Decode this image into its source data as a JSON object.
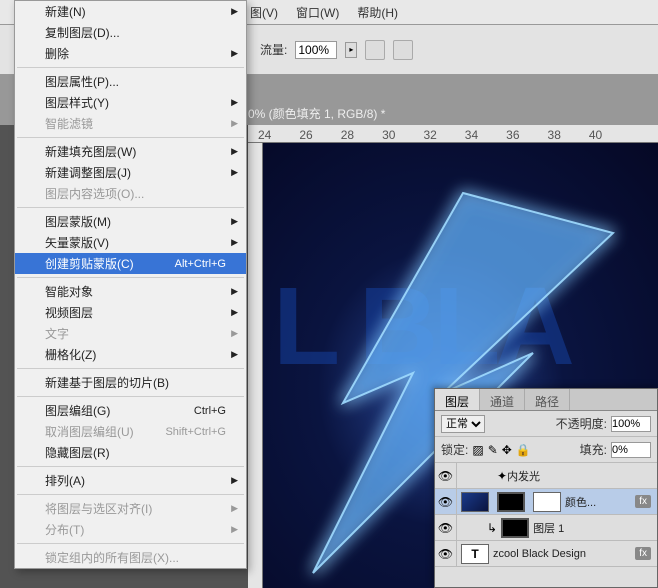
{
  "topmenu": {
    "view": "图(V)",
    "window": "窗口(W)",
    "help": "帮助(H)"
  },
  "toolbar": {
    "flow_label": "流量:",
    "flow_value": "100%"
  },
  "doc": {
    "title": "0% (颜色填充 1, RGB/8) *"
  },
  "ruler": [
    "24",
    "26",
    "28",
    "30",
    "32",
    "34",
    "36",
    "38",
    "40"
  ],
  "bgtext": "L BLA",
  "menu": {
    "new": "新建(N)",
    "copy": "复制图层(D)...",
    "delete": "删除",
    "props": "图层属性(P)...",
    "style": "图层样式(Y)",
    "smart": "智能滤镜",
    "fill": "新建填充图层(W)",
    "adjust": "新建调整图层(J)",
    "content": "图层内容选项(O)...",
    "mask": "图层蒙版(M)",
    "vmask": "矢量蒙版(V)",
    "clip": "创建剪贴蒙版(C)",
    "clip_sc": "Alt+Ctrl+G",
    "smartobj": "智能对象",
    "video": "视频图层",
    "text": "文字",
    "raster": "栅格化(Z)",
    "slice": "新建基于图层的切片(B)",
    "group": "图层编组(G)",
    "group_sc": "Ctrl+G",
    "ungroup": "取消图层编组(U)",
    "ungroup_sc": "Shift+Ctrl+G",
    "hide": "隐藏图层(R)",
    "arrange": "排列(A)",
    "align": "将图层与选区对齐(I)",
    "dist": "分布(T)",
    "lock": "锁定组内的所有图层(X)..."
  },
  "panel": {
    "tab1": "图层",
    "tab2": "通道",
    "tab3": "路径",
    "mode": "正常",
    "opacity_lbl": "不透明度:",
    "opacity": "100%",
    "lock_lbl": "锁定:",
    "fill_lbl": "填充:",
    "fill": "0%",
    "glow": "内发光",
    "l1": "颜色...",
    "l2": "图层 1",
    "l3": "zcool Black Design"
  }
}
